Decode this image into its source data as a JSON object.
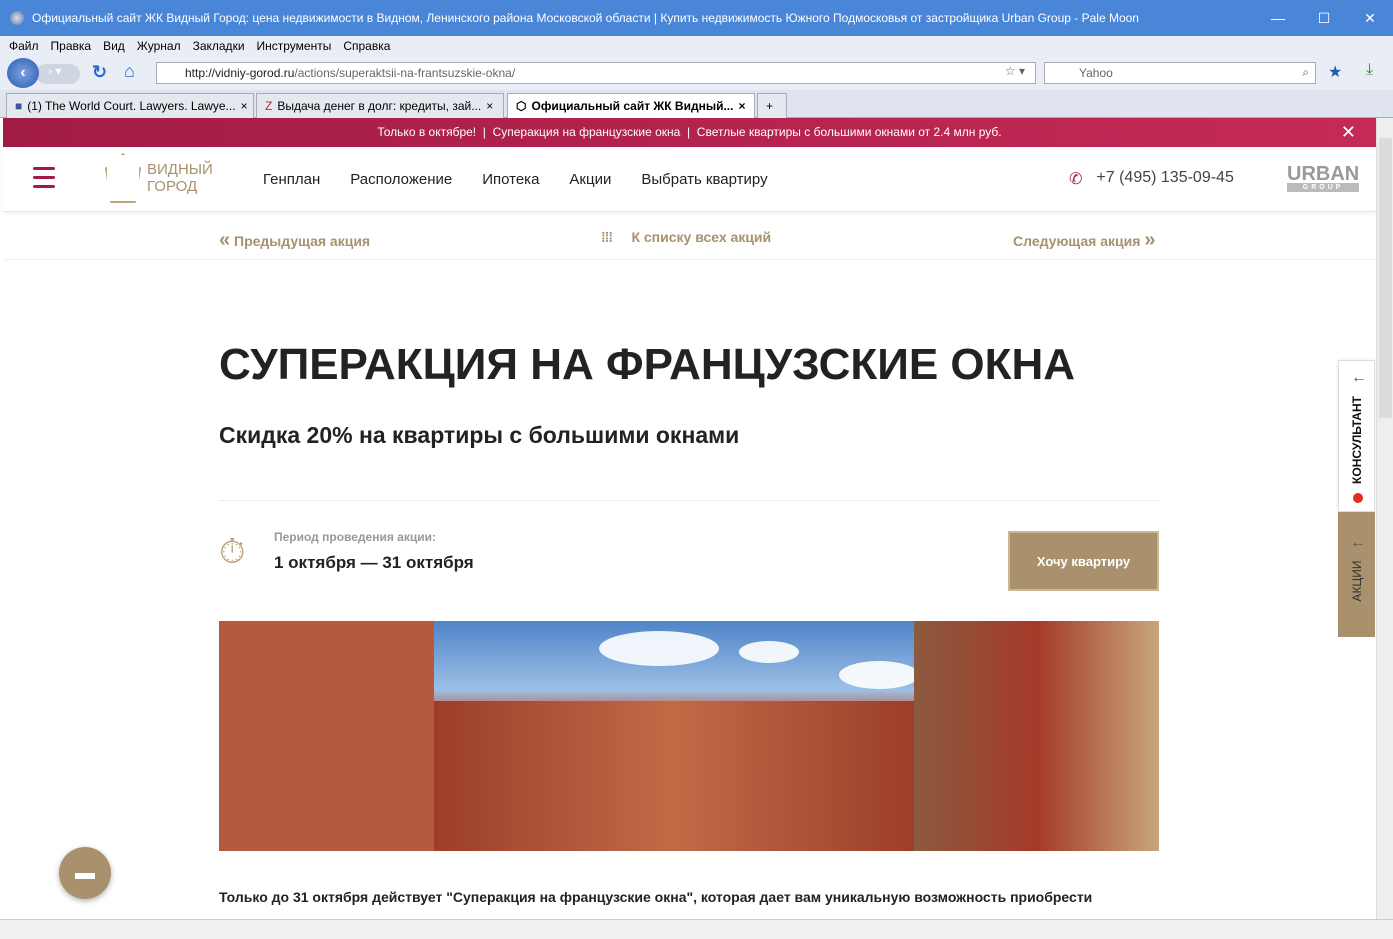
{
  "window": {
    "title": "Официальный сайт ЖК Видный Город: цена недвижимости в Видном, Ленинского района Московской области | Купить недвижимость Южного Подмосковья от застройщика Urban Group - Pale Moon"
  },
  "menu": [
    "Файл",
    "Правка",
    "Вид",
    "Журнал",
    "Закладки",
    "Инструменты",
    "Справка"
  ],
  "address": {
    "domain": "http://vidniy-gorod.ru",
    "path": "/actions/superaktsii-na-frantsuzskie-okna/"
  },
  "search": {
    "placeholder": "Yahoo"
  },
  "tabs": [
    {
      "label": "(1) The World Court. Lawyers. Lawye...",
      "active": false
    },
    {
      "label": "Выдача денег в долг: кредиты, зай...",
      "active": false
    },
    {
      "label": "Официальный сайт ЖК Видный...",
      "active": true
    }
  ],
  "promo": {
    "text": "Только в октябре!  |  Суперакция на французские окна  |  Светлые квартиры с большими окнами от 2.4 млн руб."
  },
  "site": {
    "logo": {
      "line1": "ВИДНЫЙ",
      "line2": "ГОРОД"
    },
    "nav": [
      "Генплан",
      "Расположение",
      "Ипотека",
      "Акции",
      "Выбрать квартиру"
    ],
    "phone": "+7 (495) 135-09-45",
    "brand": {
      "name": "URBAN",
      "sub": "GROUP"
    },
    "brand_color": "#a11c45",
    "accent": "#a8916c"
  },
  "subnav": {
    "prev": "Предыдущая акция",
    "list": "К списку всех акций",
    "next": "Следующая акция"
  },
  "main": {
    "title": "СУПЕРАКЦИЯ НА ФРАНЦУЗСКИЕ ОКНА",
    "subtitle": "Скидка 20% на квартиры с большими окнами",
    "period_label": "Период проведения акции:",
    "period_value": "1 октября — 31 октября",
    "cta": "Хочу квартиру",
    "body": "Только до 31 октября действует \"Суперакция на французские окна\", которая дает вам уникальную возможность приобрести"
  },
  "side": {
    "consultant": "КОНСУЛЬТАНТ",
    "actions": "АКЦИИ"
  }
}
